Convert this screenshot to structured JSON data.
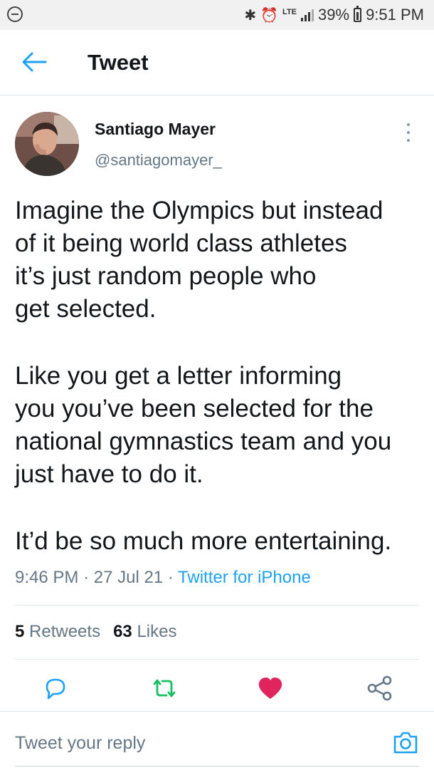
{
  "status_bar": {
    "network": "LTE",
    "battery": "39%",
    "time": "9:51 PM"
  },
  "header": {
    "title": "Tweet"
  },
  "tweet": {
    "author_name": "Santiago Mayer",
    "author_handle": "@santiagomayer_",
    "paragraphs": [
      [
        "Imagine the Olympics but instead",
        "of it being world class athletes",
        "it’s just random people who",
        "get selected."
      ],
      [
        "Like you get a letter informing",
        "you you’ve been selected for the",
        "national gymnastics team and you",
        "just have to do it."
      ],
      [
        "It’d be so much more entertaining."
      ]
    ],
    "time": "9:46 PM",
    "date": "27 Jul 21",
    "separator": "·",
    "source": "Twitter for iPhone"
  },
  "stats": {
    "retweets_count": "5",
    "retweets_label": "Retweets",
    "likes_count": "63",
    "likes_label": "Likes"
  },
  "actions": {
    "reply_icon": "comment-icon",
    "retweet_icon": "retweet-icon",
    "like_icon": "heart-icon",
    "share_icon": "share-icon"
  },
  "reply": {
    "placeholder": "Tweet your reply"
  },
  "colors": {
    "accent": "#1da1f2",
    "retweet": "#17bf63",
    "like": "#e0245e",
    "secondary_text": "#657786"
  }
}
